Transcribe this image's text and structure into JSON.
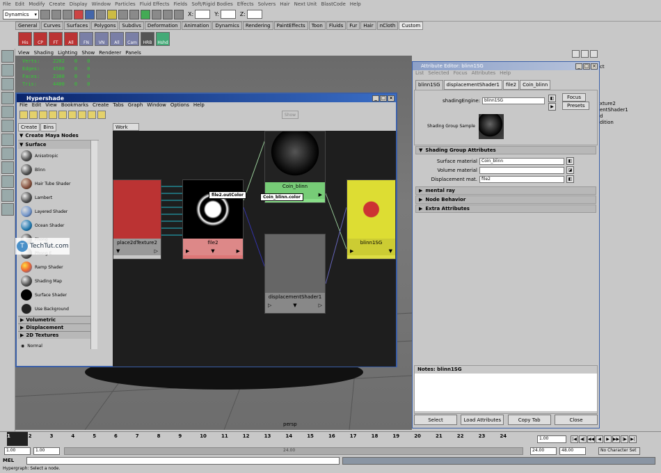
{
  "menubar": [
    "File",
    "Edit",
    "Modify",
    "Create",
    "Display",
    "Window",
    "Particles",
    "Fluid Effects",
    "Fields",
    "Soft/Rigid Bodies",
    "Effects",
    "Solvers",
    "Hair",
    "Next Unit",
    "BlastCode",
    "Help"
  ],
  "status": {
    "mode": "Dynamics",
    "x_label": "X:",
    "y_label": "Y:",
    "z_label": "Z:"
  },
  "shelf_tabs": [
    "General",
    "Curves",
    "Surfaces",
    "Polygons",
    "Subdivs",
    "Deformation",
    "Animation",
    "Dynamics",
    "Rendering",
    "PaintEffects",
    "Toon",
    "Fluids",
    "Fur",
    "Hair",
    "nCloth",
    "Custom"
  ],
  "shelf_active": "Custom",
  "shelf_icons": [
    "His",
    "CP",
    "FT",
    "All",
    "FN",
    "VN",
    "All",
    "Cam",
    "HRB",
    "Hshd"
  ],
  "viewport_menu": [
    "View",
    "Shading",
    "Lighting",
    "Show",
    "Renderer",
    "Panels"
  ],
  "hud": [
    {
      "label": "Verts:",
      "a": "2202",
      "b": "0",
      "c": "0"
    },
    {
      "label": "Edges:",
      "a": "4500",
      "b": "0",
      "c": "0"
    },
    {
      "label": "Faces:",
      "a": "2300",
      "b": "0",
      "c": "0"
    },
    {
      "label": "Tris:",
      "a": "4400",
      "b": "0",
      "c": "0"
    }
  ],
  "viewport_label": "persp",
  "hypershade": {
    "title": "Hypershade",
    "menu": [
      "File",
      "Edit",
      "View",
      "Bookmarks",
      "Create",
      "Tabs",
      "Graph",
      "Window",
      "Options",
      "Help"
    ],
    "show_label": "Show",
    "left_tabs": [
      "Create",
      "Bins"
    ],
    "create_header": "Create Maya Nodes",
    "surface_header": "Surface",
    "surface_nodes": [
      "Anisotropic",
      "Blinn",
      "Hair Tube Shader",
      "Lambert",
      "Layered Shader",
      "Ocean Shader",
      "Phong",
      "Phong E",
      "Ramp Shader",
      "Shading Map",
      "Surface Shader",
      "Use Background"
    ],
    "sections": [
      "Volumetric",
      "Displacement",
      "2D Textures"
    ],
    "normal_label": "Normal",
    "work_tab": "Work Area",
    "nodes": {
      "place2d": "place2dTexture2",
      "file2": "file2",
      "coin": "Coin_blinn",
      "disp": "displacementShader1",
      "sg": "blinn1SG"
    },
    "tooltip1": "file2.outColor",
    "tooltip2": "Coin_blinn.color"
  },
  "attr_editor": {
    "title": "Attribute Editor: blinn1SG",
    "menu": [
      "List",
      "Selected",
      "Focus",
      "Attributes",
      "Help"
    ],
    "tabs": [
      "blinn1SG",
      "displacementShader1",
      "file2",
      "Coin_blinn"
    ],
    "shading_engine_label": "shadingEngine:",
    "shading_engine_value": "blinn1SG",
    "focus": "Focus",
    "presets": "Presets",
    "sample_label": "Shading Group Sample",
    "sg_attrs_header": "Shading Group Attributes",
    "surface_material_label": "Surface material",
    "surface_material_value": "Coin_blinn",
    "volume_material_label": "Volume material",
    "displacement_label": "Displacement mat.",
    "displacement_value": "file2",
    "frames": [
      "mental ray",
      "Node Behavior",
      "Extra Attributes"
    ],
    "notes_label": "Notes:  blinn1SG",
    "buttons": [
      "Select",
      "Load Attributes",
      "Copy Tab",
      "Close"
    ]
  },
  "right_panel": {
    "lines": [
      "xture2",
      "entShader1",
      "d",
      "dition"
    ],
    "title_fragment": "ct"
  },
  "timeline": {
    "ticks": [
      "1",
      "2",
      "3",
      "4",
      "5",
      "6",
      "7",
      "8",
      "9",
      "10",
      "11",
      "12",
      "13",
      "14",
      "15",
      "16",
      "17",
      "18",
      "19",
      "20",
      "21",
      "22",
      "23",
      "24"
    ],
    "current": "1.00"
  },
  "range": {
    "start": "1.00",
    "inner_start": "1.00",
    "marker": "24.00",
    "end": "24.00",
    "outer_end": "48.00",
    "character_set": "No Character Set"
  },
  "cmd_label": "MEL",
  "help_line": "Hypergraph: Select a node.",
  "watermark": "TechTut.com",
  "watermark_logo": "T"
}
